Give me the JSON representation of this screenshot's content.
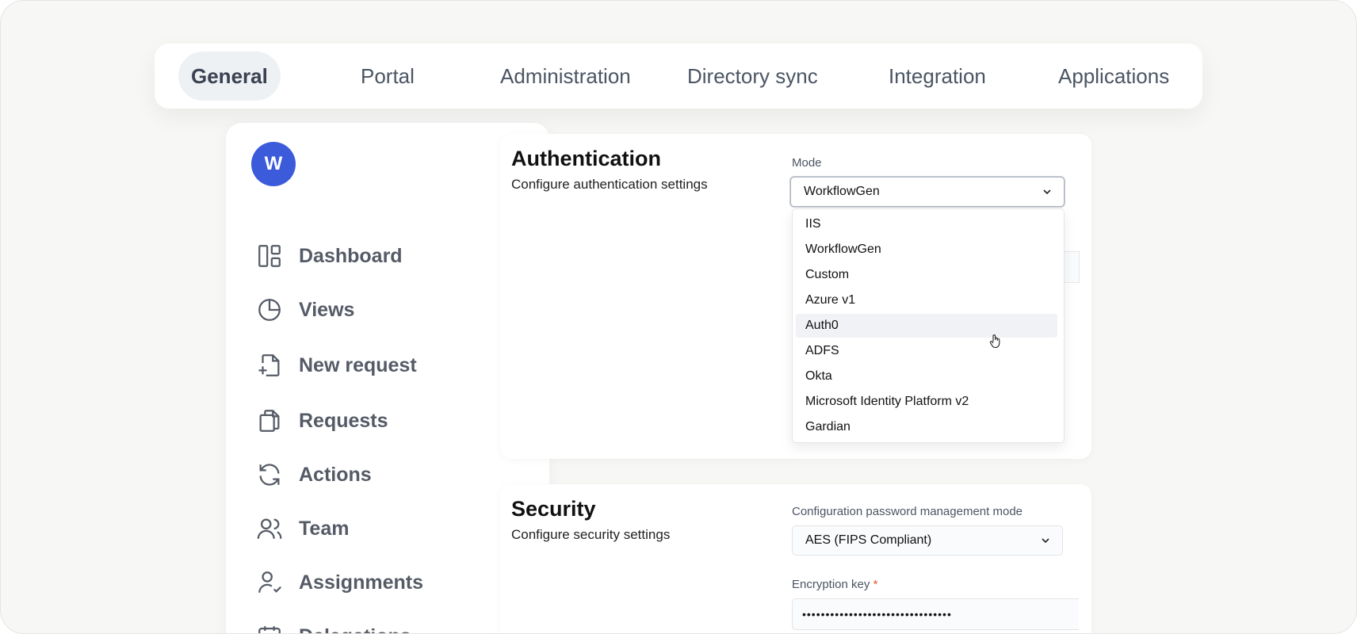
{
  "tabs": [
    {
      "label": "General",
      "active": true
    },
    {
      "label": "Portal"
    },
    {
      "label": "Administration"
    },
    {
      "label": "Directory sync"
    },
    {
      "label": "Integration"
    },
    {
      "label": "Applications"
    }
  ],
  "user": {
    "avatar_initial": "W"
  },
  "sidebar": {
    "items": [
      {
        "label": "Dashboard",
        "icon": "dashboard-icon"
      },
      {
        "label": "Views",
        "icon": "pie-chart-icon"
      },
      {
        "label": "New request",
        "icon": "file-plus-icon"
      },
      {
        "label": "Requests",
        "icon": "files-icon"
      },
      {
        "label": "Actions",
        "icon": "refresh-icon"
      },
      {
        "label": "Team",
        "icon": "users-icon"
      },
      {
        "label": "Assignments",
        "icon": "user-check-icon"
      },
      {
        "label": "Delegations",
        "icon": "calendar-icon"
      }
    ]
  },
  "authentication": {
    "title": "Authentication",
    "subtitle": "Configure authentication settings",
    "mode_label": "Mode",
    "mode_value": "WorkflowGen",
    "options": [
      "IIS",
      "WorkflowGen",
      "Custom",
      "Azure v1",
      "Auth0",
      "ADFS",
      "Okta",
      "Microsoft Identity Platform v2",
      "Gardian"
    ],
    "hovered_option": "Auth0"
  },
  "security": {
    "title": "Security",
    "subtitle": "Configure security settings",
    "password_mode_label": "Configuration password management mode",
    "password_mode_value": "AES (FIPS Compliant)",
    "encryption_key_label": "Encryption key",
    "required_marker": "*",
    "encryption_key_value": "••••••••••••••••••••••••••••••••"
  },
  "colors": {
    "accent": "#3b5bdb",
    "required": "#e4572e",
    "icon_stroke": "#555b66"
  }
}
